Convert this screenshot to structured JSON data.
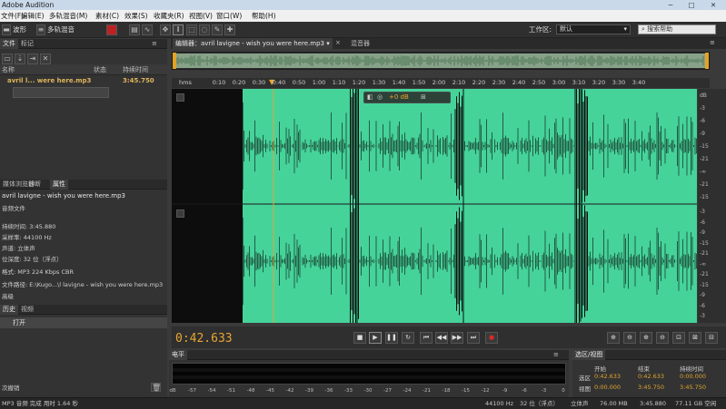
{
  "window": {
    "title": "Adobe Audition"
  },
  "menu": [
    "文件(F)",
    "编辑(E)",
    "多轨混音(M)",
    "素材(C)",
    "效果(S)",
    "收藏夹(R)",
    "视图(V)",
    "窗口(W)",
    "帮助(H)"
  ],
  "toolbar": {
    "waveform_label": "波形",
    "multitrack_label": "多轨混音",
    "workspace_label": "工作区:",
    "workspace_value": "默认",
    "search_placeholder": "搜索帮助"
  },
  "files_panel": {
    "tabs": [
      "文件",
      "标记"
    ],
    "columns": {
      "name": "名称",
      "status": "状态",
      "duration": "持续时间"
    },
    "file": {
      "name": "avril l... were here.mp3",
      "duration": "3:45.750"
    }
  },
  "properties_panel": {
    "tabs": [
      "媒体浏览器",
      "诊断",
      "属性"
    ],
    "file_name": "avril lavigne - wish you were here.mp3",
    "kind": "音频文件",
    "rows": [
      {
        "label": "持续时间:",
        "value": "3:45.880"
      },
      {
        "label": "采样率:",
        "value": "44100 Hz"
      },
      {
        "label": "声道:",
        "value": "立体声"
      },
      {
        "label": "位深度:",
        "value": "32 位（浮点）"
      },
      {
        "label": "格式:",
        "value": "MP3 224 Kbps CBR"
      },
      {
        "label": "文件路径:",
        "value": "E:\\Kugo...\\l lavigne - wish you were here.mp3"
      }
    ],
    "advanced": "高级"
  },
  "history_panel": {
    "tabs": [
      "历史",
      "视频"
    ],
    "item": "打开",
    "footer": "次撤销"
  },
  "editor": {
    "tab_label": "编辑器：avril lavigne - wish you were here.mp3",
    "mixer_tab": "混音器",
    "ruler_unit": "hms",
    "ruler_labels": [
      "0:10",
      "0:20",
      "0:30",
      "0:40",
      "0:50",
      "1:00",
      "1:10",
      "1:20",
      "1:30",
      "1:40",
      "1:50",
      "2:00",
      "2:10",
      "2:20",
      "2:30",
      "2:40",
      "2:50",
      "3:00",
      "3:10",
      "3:20",
      "3:30",
      "3:40"
    ],
    "hud_gain": "+0 dB",
    "db_labels_ch1": [
      "dB",
      "-3",
      "-6",
      "-9",
      "-15",
      "-21",
      "-∞",
      "-21",
      "-15"
    ],
    "db_labels_ch2": [
      "-3",
      "-6",
      "-9",
      "-15",
      "-21",
      "-∞",
      "-21",
      "-15",
      "-9",
      "-6",
      "-3"
    ],
    "playhead_time": "0:42.633",
    "waveform_color": "#45d39a"
  },
  "transport": {
    "current_time": "0:42.633",
    "buttons": [
      "stop",
      "play",
      "pause",
      "loop",
      "rewind-start",
      "rewind",
      "fast-forward",
      "forward-end",
      "record"
    ]
  },
  "levels_panel": {
    "title": "电平",
    "ticks": [
      "dB",
      "-57",
      "-54",
      "-51",
      "-48",
      "-45",
      "-42",
      "-39",
      "-36",
      "-33",
      "-30",
      "-27",
      "-24",
      "-21",
      "-18",
      "-15",
      "-12",
      "-9",
      "-6",
      "-3",
      "0"
    ]
  },
  "selection_panel": {
    "title": "选区/视图",
    "headers": [
      "开始",
      "结束",
      "持续时间"
    ],
    "rows": [
      {
        "label": "选区",
        "start": "0:42.633",
        "end": "0:42.633",
        "duration": "0:00.000"
      },
      {
        "label": "视图",
        "start": "0:00.000",
        "end": "3:45.750",
        "duration": "3:45.750"
      }
    ]
  },
  "status": {
    "left": "MP3 音频 完成 用时 1.64 秒",
    "sample_rate": "44100 Hz",
    "bit_depth": "32 位（浮点）",
    "channels": "立体声",
    "size": "76.00 MB",
    "duration": "3:45.880",
    "free": "77.11 GB 空闲"
  }
}
